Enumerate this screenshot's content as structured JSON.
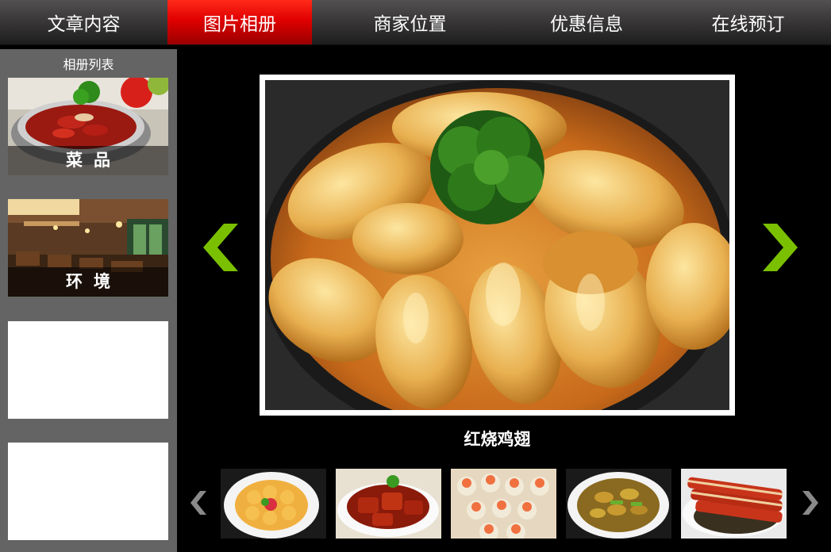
{
  "nav": {
    "tabs": [
      {
        "label": "文章内容",
        "active": false
      },
      {
        "label": "图片相册",
        "active": true
      },
      {
        "label": "商家位置",
        "active": false
      },
      {
        "label": "优惠信息",
        "active": false
      },
      {
        "label": "在线预订",
        "active": false
      }
    ]
  },
  "sidebar": {
    "title": "相册列表",
    "albums": [
      {
        "label": "菜品"
      },
      {
        "label": "环境"
      }
    ]
  },
  "viewer": {
    "caption": "红烧鸡翅"
  },
  "colors": {
    "active_tab": "#e00000",
    "arrow_green": "#7ac000",
    "sidebar_bg": "#646464"
  },
  "icons": {
    "prev": "chevron-left-icon",
    "next": "chevron-right-icon",
    "thumb_prev": "chevron-left-icon",
    "thumb_next": "chevron-right-icon"
  }
}
